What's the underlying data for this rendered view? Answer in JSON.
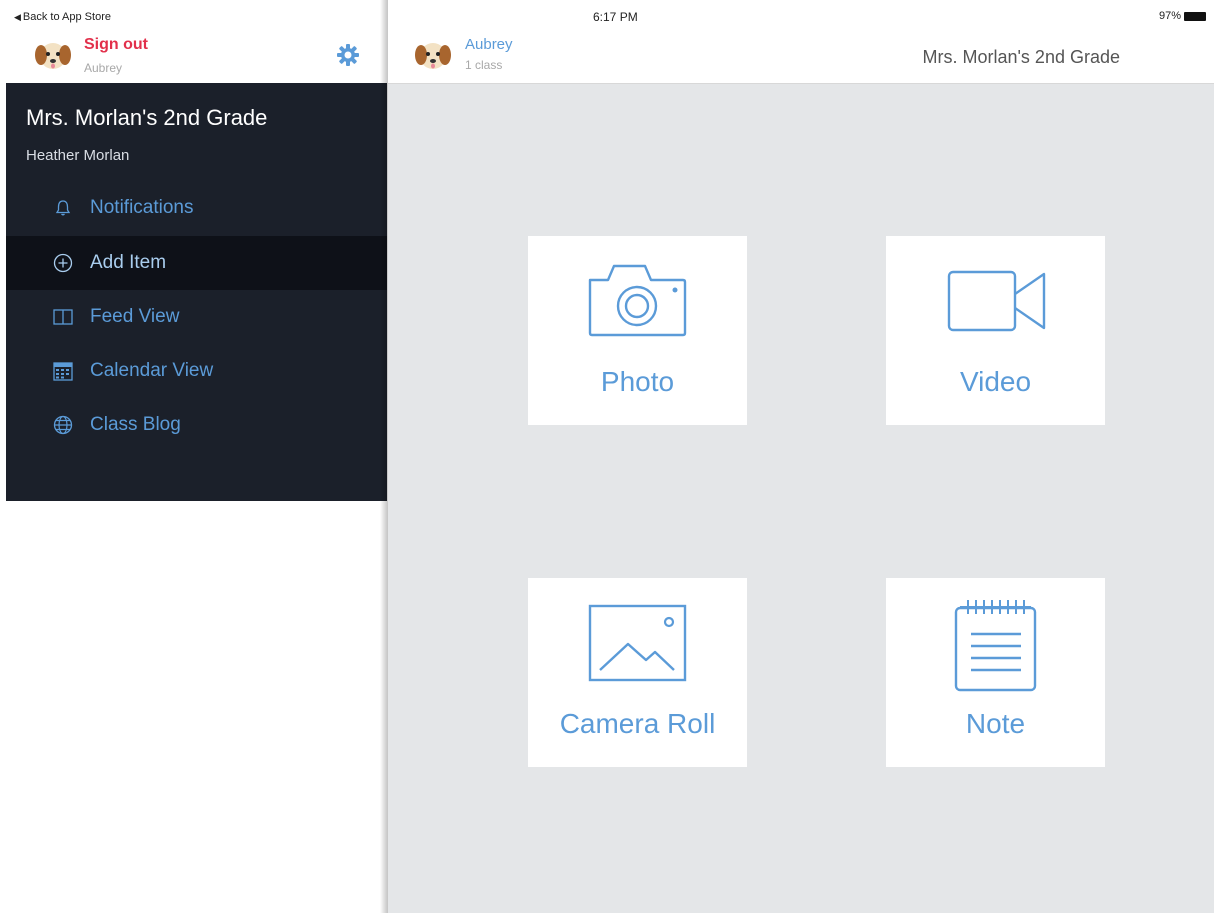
{
  "status_bar": {
    "back_label": "Back to App Store",
    "time": "6:17 PM",
    "battery": "97%"
  },
  "sidebar": {
    "signout_label": "Sign out",
    "user_name": "Aubrey",
    "class_title": "Mrs. Morlan's 2nd Grade",
    "teacher_name": "Heather Morlan",
    "menu": [
      {
        "label": "Notifications",
        "icon": "bell-icon"
      },
      {
        "label": "Add Item",
        "icon": "plus-circle-icon",
        "active": true
      },
      {
        "label": "Feed View",
        "icon": "book-icon"
      },
      {
        "label": "Calendar View",
        "icon": "calendar-icon"
      },
      {
        "label": "Class Blog",
        "icon": "globe-icon"
      }
    ]
  },
  "topbar": {
    "user_name": "Aubrey",
    "class_count": "1 class",
    "class_name": "Mrs. Morlan's 2nd Grade"
  },
  "tiles": {
    "photo": "Photo",
    "video": "Video",
    "camera_roll": "Camera Roll",
    "note": "Note"
  },
  "colors": {
    "accent": "#5b9bd8",
    "signout": "#e2304b",
    "sidebar_bg": "#1b202a",
    "active_item_bg": "#0e1118",
    "main_bg": "#e4e6e8"
  }
}
